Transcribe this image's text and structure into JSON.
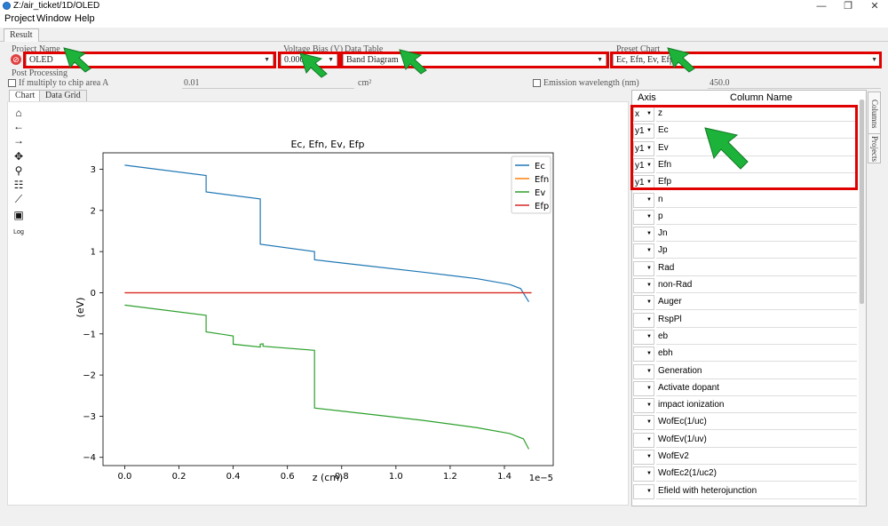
{
  "window": {
    "title": "Z:/air_ticket/1D/OLED",
    "minimize": "—",
    "maximize": "❐",
    "close": "✕"
  },
  "menu": [
    "Project",
    "Window",
    "Help"
  ],
  "tab_top": "Result",
  "fields": {
    "project_name_label": "Project Name",
    "project_name_value": "OLED",
    "voltage_label": "Voltage Bias (V)",
    "voltage_value": "0.000",
    "data_table_label": "Data Table",
    "data_table_value": "Band Diagram",
    "preset_chart_label": "Preset Chart",
    "preset_chart_value": "Ec, Efn, Ev, Efp"
  },
  "post_processing": {
    "title": "Post Processing",
    "multiply_label": "If multiply to chip area A",
    "area_value": "0.01",
    "area_unit": "cm²",
    "emission_label": "Emission wavelength (nm)",
    "emission_value": "450.0"
  },
  "subtabs": [
    "Chart",
    "Data Grid"
  ],
  "toolbar": {
    "home": "⌂",
    "back": "←",
    "forward": "→",
    "pan": "✥",
    "zoom": "⚲",
    "configure": "☷",
    "edit": "⟋",
    "save": "▣",
    "log": "Log"
  },
  "columns_panel": {
    "axis_header": "Axis",
    "name_header": "Column Name",
    "rows": [
      {
        "axis": "x",
        "name": "z"
      },
      {
        "axis": "y1",
        "name": "Ec"
      },
      {
        "axis": "y1",
        "name": "Ev"
      },
      {
        "axis": "y1",
        "name": "Efn"
      },
      {
        "axis": "y1",
        "name": "Efp"
      },
      {
        "axis": "",
        "name": "n"
      },
      {
        "axis": "",
        "name": "p"
      },
      {
        "axis": "",
        "name": "Jn"
      },
      {
        "axis": "",
        "name": "Jp"
      },
      {
        "axis": "",
        "name": "Rad"
      },
      {
        "axis": "",
        "name": "non-Rad"
      },
      {
        "axis": "",
        "name": "Auger"
      },
      {
        "axis": "",
        "name": "RspPl"
      },
      {
        "axis": "",
        "name": "eb"
      },
      {
        "axis": "",
        "name": "ebh"
      },
      {
        "axis": "",
        "name": "Generation"
      },
      {
        "axis": "",
        "name": "Activate dopant"
      },
      {
        "axis": "",
        "name": "impact ionization"
      },
      {
        "axis": "",
        "name": "WofEc(1/uc)"
      },
      {
        "axis": "",
        "name": "WofEv(1/uv)"
      },
      {
        "axis": "",
        "name": "WofEv2"
      },
      {
        "axis": "",
        "name": "WofEc2(1/uc2)"
      },
      {
        "axis": "",
        "name": "Efield with heterojunction"
      }
    ]
  },
  "side_tabs": [
    "Columns",
    "Projects"
  ],
  "chart_data": {
    "type": "line",
    "title": "Ec, Efn, Ev, Efp",
    "xlabel": "z (cm)",
    "ylabel": "(eV)",
    "x_multiplier": "1e−5",
    "xlim": [
      -0.08,
      1.58
    ],
    "ylim": [
      -4.2,
      3.4
    ],
    "xticks": [
      "0.0",
      "0.2",
      "0.4",
      "0.6",
      "0.8",
      "1.0",
      "1.2",
      "1.4"
    ],
    "xtick_values": [
      0,
      0.2,
      0.4,
      0.6,
      0.8,
      1.0,
      1.2,
      1.4
    ],
    "yticks": [
      "3",
      "2",
      "1",
      "0",
      "−1",
      "−2",
      "−3",
      "−4"
    ],
    "ytick_values": [
      3,
      2,
      1,
      0,
      -1,
      -2,
      -3,
      -4
    ],
    "legend_position": "top-right",
    "grid": false,
    "series": [
      {
        "name": "Ec",
        "color": "#1f77b4",
        "x": [
          0,
          0.3,
          0.3,
          0.5,
          0.5,
          0.7,
          0.7,
          0.9,
          1.1,
          1.3,
          1.42,
          1.46,
          1.49
        ],
        "y": [
          3.1,
          2.85,
          2.45,
          2.28,
          1.18,
          1.0,
          0.8,
          0.65,
          0.5,
          0.34,
          0.2,
          0.1,
          -0.22
        ]
      },
      {
        "name": "Efn",
        "color": "#ff7f0e",
        "x": [
          0,
          1.5
        ],
        "y": [
          0,
          0
        ]
      },
      {
        "name": "Ev",
        "color": "#2ca02c",
        "x": [
          0,
          0.3,
          0.3,
          0.4,
          0.4,
          0.5,
          0.5,
          0.51,
          0.51,
          0.7,
          0.7,
          0.9,
          1.1,
          1.3,
          1.42,
          1.47,
          1.49
        ],
        "y": [
          -0.3,
          -0.55,
          -0.95,
          -1.05,
          -1.25,
          -1.32,
          -1.25,
          -1.24,
          -1.3,
          -1.4,
          -2.8,
          -2.95,
          -3.1,
          -3.28,
          -3.42,
          -3.55,
          -3.8
        ]
      },
      {
        "name": "Efp",
        "color": "#d62728",
        "x": [
          0,
          1.5
        ],
        "y": [
          0,
          0
        ]
      }
    ]
  }
}
